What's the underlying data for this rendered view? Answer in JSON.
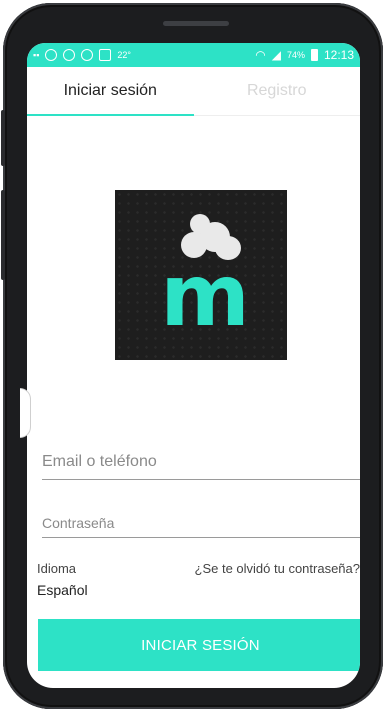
{
  "status_bar": {
    "temperature": "22°",
    "battery_percent": "74%",
    "time": "12:13"
  },
  "tabs": [
    {
      "label": "Iniciar sesión",
      "active": true
    },
    {
      "label": "Registro",
      "active": false
    }
  ],
  "logo": {
    "letter": "m"
  },
  "form": {
    "email_placeholder": "Email o teléfono",
    "password_placeholder": "Contraseña"
  },
  "language": {
    "label": "Idioma",
    "value": "Español"
  },
  "forgot_password": "¿Se te olvidó tu contraseña?",
  "login_button": "INICIAR SESIÓN",
  "colors": {
    "accent": "#2de2c6",
    "logo_bg": "#1e1e1e"
  }
}
